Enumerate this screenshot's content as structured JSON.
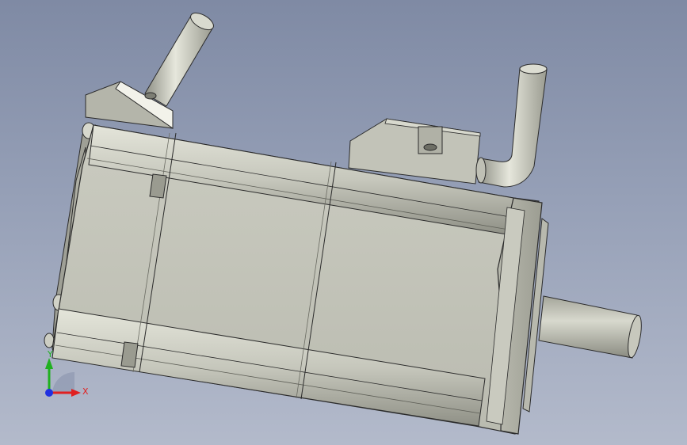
{
  "viewport": {
    "background_top": "#7f8aa4",
    "background_bottom": "#b3bacb",
    "model_name": "servo-motor"
  },
  "triad": {
    "x_label": "X",
    "y_label": "Y",
    "x_color": "#e02020",
    "y_color": "#20b020",
    "z_color": "#2030e0"
  },
  "colors": {
    "body_face": "#c3c4b8",
    "body_light": "#d4d5ca",
    "body_shadow": "#8c8d82",
    "edge": "#2b2b2b"
  }
}
